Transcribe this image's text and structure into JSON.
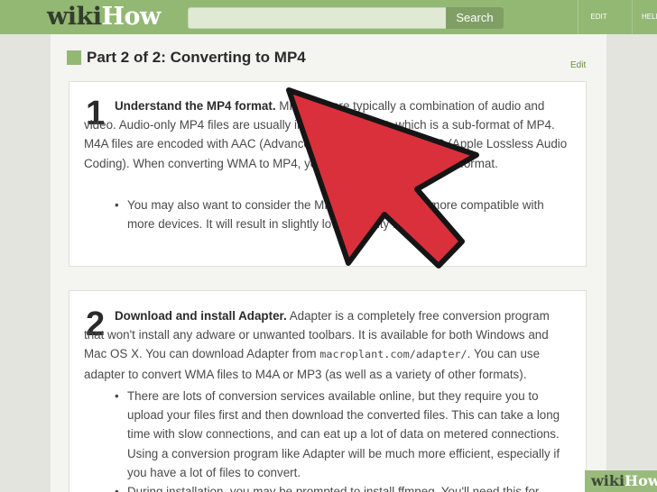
{
  "header": {
    "logo_wiki": "wiki",
    "logo_how": "How",
    "search_button": "Search",
    "nav_edit": "EDIT",
    "nav_help": "HELP"
  },
  "section": {
    "title": "Part 2 of 2: Converting to MP4",
    "edit": "Edit"
  },
  "steps": [
    {
      "number": "1",
      "title": "Understand the MP4 format.",
      "body": " MP4 files are typically a combination of audio and video. Audio-only MP4 files are usually in the M4A format, which is a sub-format of MP4. M4A files are encoded with AAC (Advanced Audio Coding) or ALAC (Apple Lossless Audio Coding). When converting WMA to MP4, you're converting to the M4A format.",
      "bullets": [
        "You may also want to consider the MP3 format, which is more compatible with more devices. It will result in slightly lower quality than M4A."
      ]
    },
    {
      "number": "2",
      "title": "Download and install Adapter.",
      "body_a": " Adapter is a completely free conversion program that won't install any adware or unwanted toolbars. It is available for both Windows and Mac OS X. You can download Adapter from ",
      "url": "macroplant.com/adapter/",
      "body_b": ". You can use adapter to convert WMA files to M4A or MP3 (as well as a variety of other formats).",
      "bullets": [
        "There are lots of conversion services available online, but they require you to upload your files first and then download the converted files. This can take a long time with slow connections, and can eat up a lot of data on metered connections. Using a conversion program like Adapter will be much more efficient, especially if you have a lot of files to convert.",
        "During installation, you may be prompted to install ffmpeg. You'll need this for"
      ]
    }
  ],
  "watermark": {
    "wiki": "wiki",
    "how": "How"
  },
  "colors": {
    "brand_green": "#93b874",
    "arrow_red": "#d9303c"
  },
  "icons": {
    "pointer": "big-red-arrow-icon"
  }
}
